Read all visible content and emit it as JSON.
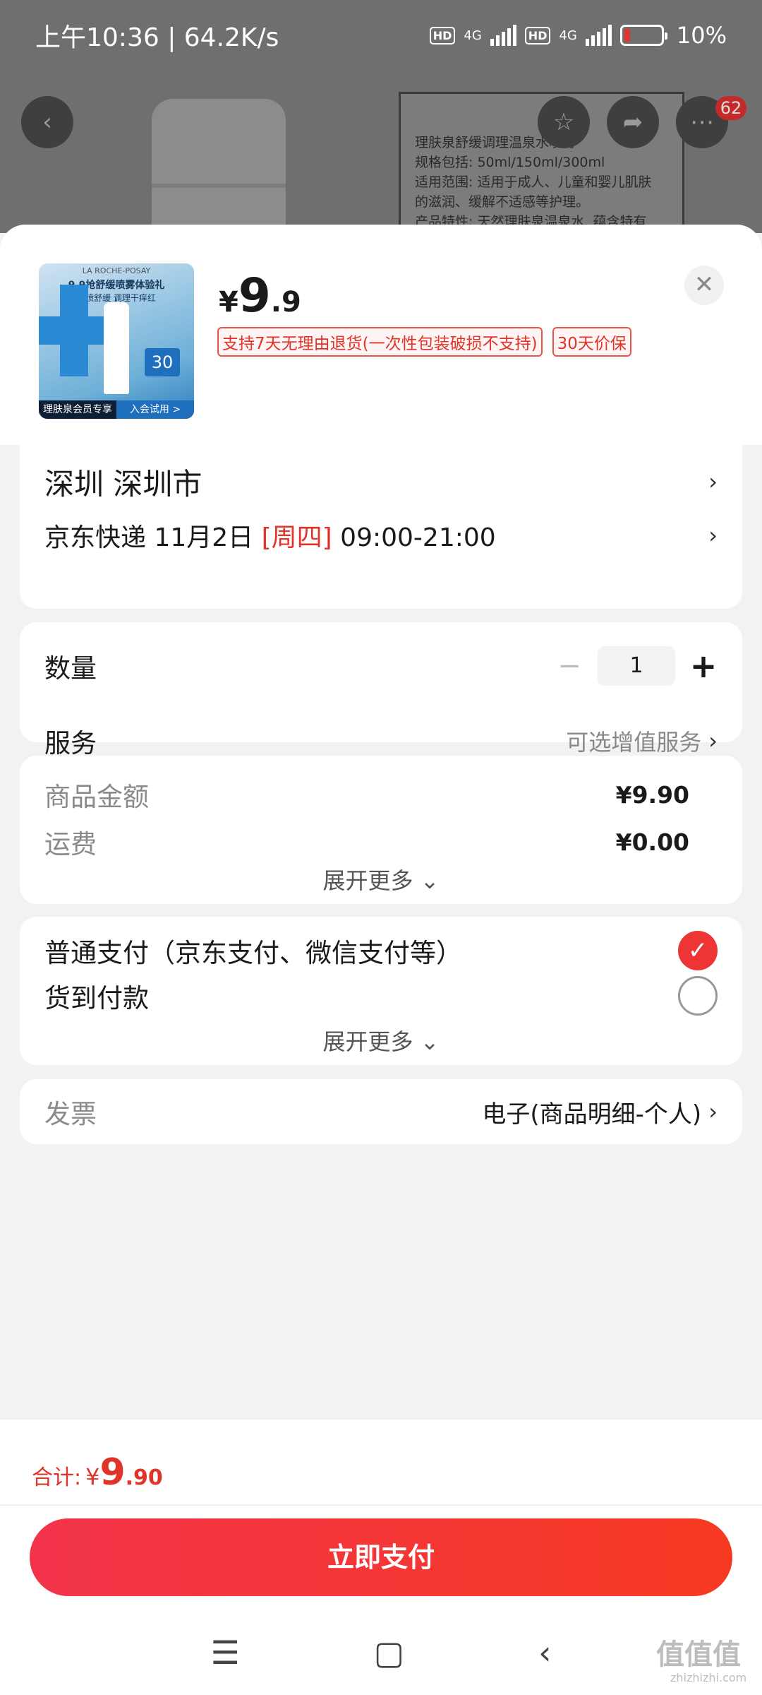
{
  "status_bar": {
    "time": "上午10:36 | 64.2K/s",
    "net_a": "4G",
    "net_b": "4G",
    "battery": "10%"
  },
  "background": {
    "label_text": "理肤泉舒缓调理温泉水喷雾\n规格包括: 50ml/150ml/300ml\n适用范围: 适用于成人、儿童和婴儿肌肤\n的滋润、缓解不适感等护理。\n产品特性: 天然理肤泉温泉水, 蕴含特有",
    "badge_count": "62"
  },
  "product": {
    "thumb": {
      "header": "LA ROCHE-POSAY",
      "title": "9.9抢舒缓喷雾体验礼",
      "subtitle": "一喷舒缓 调理干痒红",
      "box": "30",
      "strip_left": "理肤泉会员专享",
      "strip_right": "入会试用 >"
    },
    "price_currency": "¥",
    "price_int": "9",
    "price_dec": ".9",
    "tags": [
      "支持7天无理由退货(一次性包装破损不支持)",
      "30天价保"
    ]
  },
  "address": {
    "location": "深圳  深圳市",
    "delivery_carrier": "京东快递 11月2日",
    "delivery_weekday": "[周四]",
    "delivery_time": "09:00-21:00"
  },
  "options": {
    "quantity_label": "数量",
    "quantity_value": "1",
    "service_label": "服务",
    "service_hint": "可选增值服务"
  },
  "amounts": {
    "goods_label": "商品金额",
    "goods_value": "¥9.90",
    "shipping_label": "运费",
    "shipping_value": "¥0.00",
    "expand": "展开更多 ⌄"
  },
  "payment": {
    "normal": "普通支付（京东支付、微信支付等）",
    "cod": "货到付款",
    "expand": "展开更多 ⌄",
    "selected": "normal"
  },
  "invoice": {
    "label": "发票",
    "value": "电子(商品明细-个人)"
  },
  "footer": {
    "total_label": "合计:",
    "total_currency": "¥",
    "total_int": "9",
    "total_dec": ".90",
    "pay_button": "立即支付"
  },
  "watermark": {
    "logo": "值值值",
    "site": "zhizhizhi.com"
  },
  "colors": {
    "accent": "#e0342a",
    "pay_gradient_start": "#f2334a",
    "pay_gradient_end": "#f63a22"
  },
  "icons": [
    "back-icon",
    "star-icon",
    "share-icon",
    "more-icon",
    "close-icon",
    "chevron-right-icon",
    "check-icon",
    "menu-icon",
    "home-icon",
    "back-nav-icon"
  ]
}
